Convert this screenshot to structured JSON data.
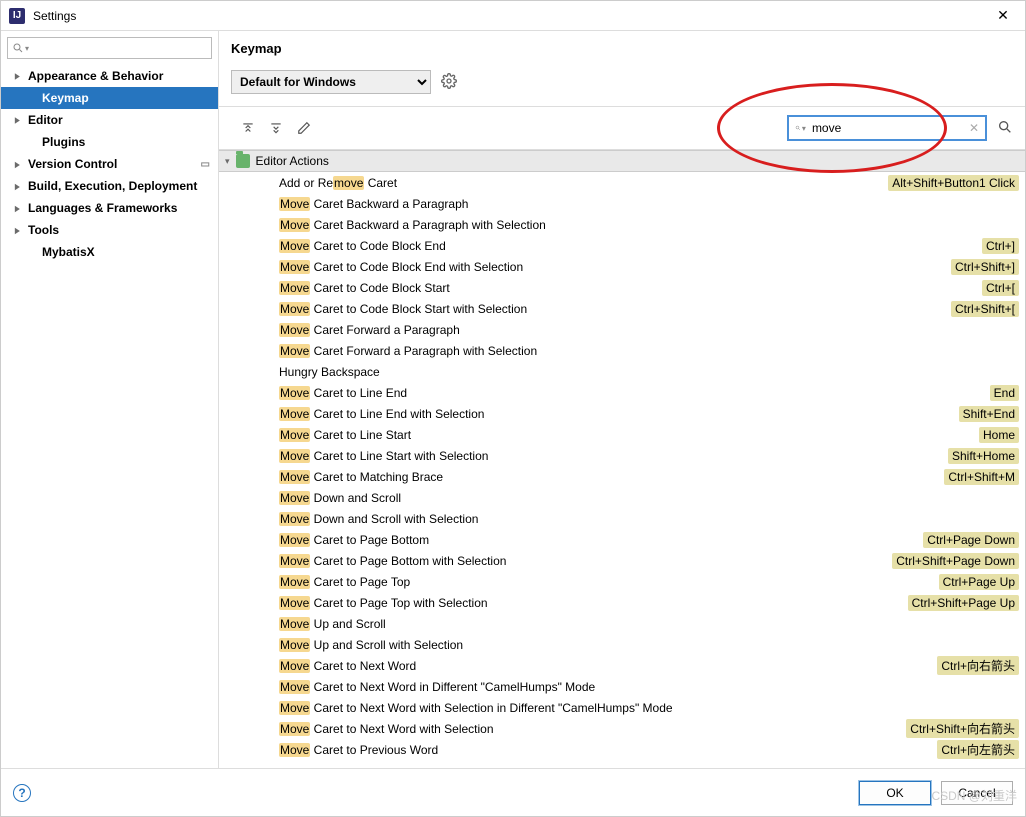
{
  "window": {
    "title": "Settings"
  },
  "sidebar": {
    "search_placeholder": "",
    "items": [
      {
        "label": "Appearance & Behavior",
        "expandable": true,
        "bold": true
      },
      {
        "label": "Keymap",
        "selected": true,
        "bold": true,
        "sub": true
      },
      {
        "label": "Editor",
        "expandable": true,
        "bold": true
      },
      {
        "label": "Plugins",
        "sub": true,
        "bold": true
      },
      {
        "label": "Version Control",
        "expandable": true,
        "bold": true,
        "modified": true
      },
      {
        "label": "Build, Execution, Deployment",
        "expandable": true,
        "bold": true
      },
      {
        "label": "Languages & Frameworks",
        "expandable": true,
        "bold": true
      },
      {
        "label": "Tools",
        "expandable": true,
        "bold": true
      },
      {
        "label": "MybatisX",
        "sub": true,
        "bold": true
      }
    ]
  },
  "crumb": "Keymap",
  "scheme": {
    "selected": "Default for Windows"
  },
  "search": {
    "value": "move",
    "highlight": "move"
  },
  "group": "Editor Actions",
  "actions": [
    {
      "pre": "Add or Re",
      "hl": "move",
      "post": " Caret",
      "sc": "Alt+Shift+Button1 Click"
    },
    {
      "pre": "",
      "hl": "Move",
      "post": " Caret Backward a Paragraph"
    },
    {
      "pre": "",
      "hl": "Move",
      "post": " Caret Backward a Paragraph with Selection"
    },
    {
      "pre": "",
      "hl": "Move",
      "post": " Caret to Code Block End",
      "sc": "Ctrl+]"
    },
    {
      "pre": "",
      "hl": "Move",
      "post": " Caret to Code Block End with Selection",
      "sc": "Ctrl+Shift+]"
    },
    {
      "pre": "",
      "hl": "Move",
      "post": " Caret to Code Block Start",
      "sc": "Ctrl+["
    },
    {
      "pre": "",
      "hl": "Move",
      "post": " Caret to Code Block Start with Selection",
      "sc": "Ctrl+Shift+["
    },
    {
      "pre": "",
      "hl": "Move",
      "post": " Caret Forward a Paragraph"
    },
    {
      "pre": "",
      "hl": "Move",
      "post": " Caret Forward a Paragraph with Selection"
    },
    {
      "plain": "Hungry Backspace"
    },
    {
      "pre": "",
      "hl": "Move",
      "post": " Caret to Line End",
      "sc": "End"
    },
    {
      "pre": "",
      "hl": "Move",
      "post": " Caret to Line End with Selection",
      "sc": "Shift+End"
    },
    {
      "pre": "",
      "hl": "Move",
      "post": " Caret to Line Start",
      "sc": "Home"
    },
    {
      "pre": "",
      "hl": "Move",
      "post": " Caret to Line Start with Selection",
      "sc": "Shift+Home"
    },
    {
      "pre": "",
      "hl": "Move",
      "post": " Caret to Matching Brace",
      "sc": "Ctrl+Shift+M"
    },
    {
      "pre": "",
      "hl": "Move",
      "post": " Down and Scroll"
    },
    {
      "pre": "",
      "hl": "Move",
      "post": " Down and Scroll with Selection"
    },
    {
      "pre": "",
      "hl": "Move",
      "post": " Caret to Page Bottom",
      "sc": "Ctrl+Page Down"
    },
    {
      "pre": "",
      "hl": "Move",
      "post": " Caret to Page Bottom with Selection",
      "sc": "Ctrl+Shift+Page Down"
    },
    {
      "pre": "",
      "hl": "Move",
      "post": " Caret to Page Top",
      "sc": "Ctrl+Page Up"
    },
    {
      "pre": "",
      "hl": "Move",
      "post": " Caret to Page Top with Selection",
      "sc": "Ctrl+Shift+Page Up"
    },
    {
      "pre": "",
      "hl": "Move",
      "post": " Up and Scroll"
    },
    {
      "pre": "",
      "hl": "Move",
      "post": " Up and Scroll with Selection"
    },
    {
      "pre": "",
      "hl": "Move",
      "post": " Caret to Next Word",
      "sc": "Ctrl+向右箭头"
    },
    {
      "pre": "",
      "hl": "Move",
      "post": " Caret to Next Word in Different \"CamelHumps\" Mode"
    },
    {
      "pre": "",
      "hl": "Move",
      "post": " Caret to Next Word with Selection in Different \"CamelHumps\" Mode"
    },
    {
      "pre": "",
      "hl": "Move",
      "post": " Caret to Next Word with Selection",
      "sc": "Ctrl+Shift+向右箭头"
    },
    {
      "pre": "",
      "hl": "Move",
      "post": " Caret to Previous Word",
      "sc": "Ctrl+向左箭头"
    }
  ],
  "footer": {
    "ok": "OK",
    "cancel": "Cancel"
  },
  "watermark": "CSDN @刘重洋"
}
